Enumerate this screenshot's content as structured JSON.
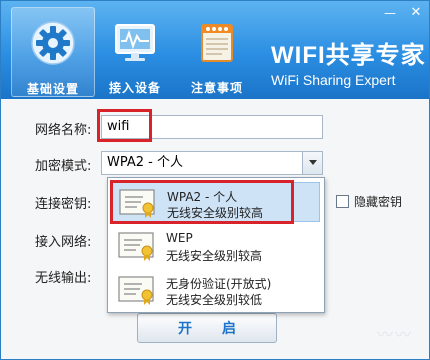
{
  "window_controls": {
    "minimize": "—",
    "close": "✕"
  },
  "nav": {
    "tabs": [
      {
        "label": "基础设置",
        "icon": "gear-icon",
        "active": true
      },
      {
        "label": "接入设备",
        "icon": "monitor-chart-icon",
        "active": false
      },
      {
        "label": "注意事项",
        "icon": "notepad-icon",
        "active": false
      }
    ]
  },
  "brand": {
    "title": "WIFI共享专家",
    "subtitle": "WiFi Sharing Expert"
  },
  "form": {
    "network_name_label": "网络名称:",
    "network_name_value": "wifi",
    "encryption_label": "加密模式:",
    "encryption_value": "WPA2 - 个人",
    "key_label": "连接密钥:",
    "access_network_label": "接入网络:",
    "wireless_output_label": "无线输出:",
    "hide_key_label": "隐藏密钥",
    "hide_key_checked": false
  },
  "dropdown": {
    "options": [
      {
        "name": "WPA2 - 个人",
        "desc": "无线安全级别较高",
        "selected": true
      },
      {
        "name": "WEP",
        "desc": "无线安全级别较高",
        "selected": false
      },
      {
        "name": "无身份验证(开放式)",
        "desc": "无线安全级别较低",
        "selected": false
      }
    ]
  },
  "start_button": {
    "char1": "开",
    "char2": "启"
  },
  "colors": {
    "header": "#2b8ee2",
    "highlight": "#d8232a",
    "accent_text": "#1c73c9"
  }
}
